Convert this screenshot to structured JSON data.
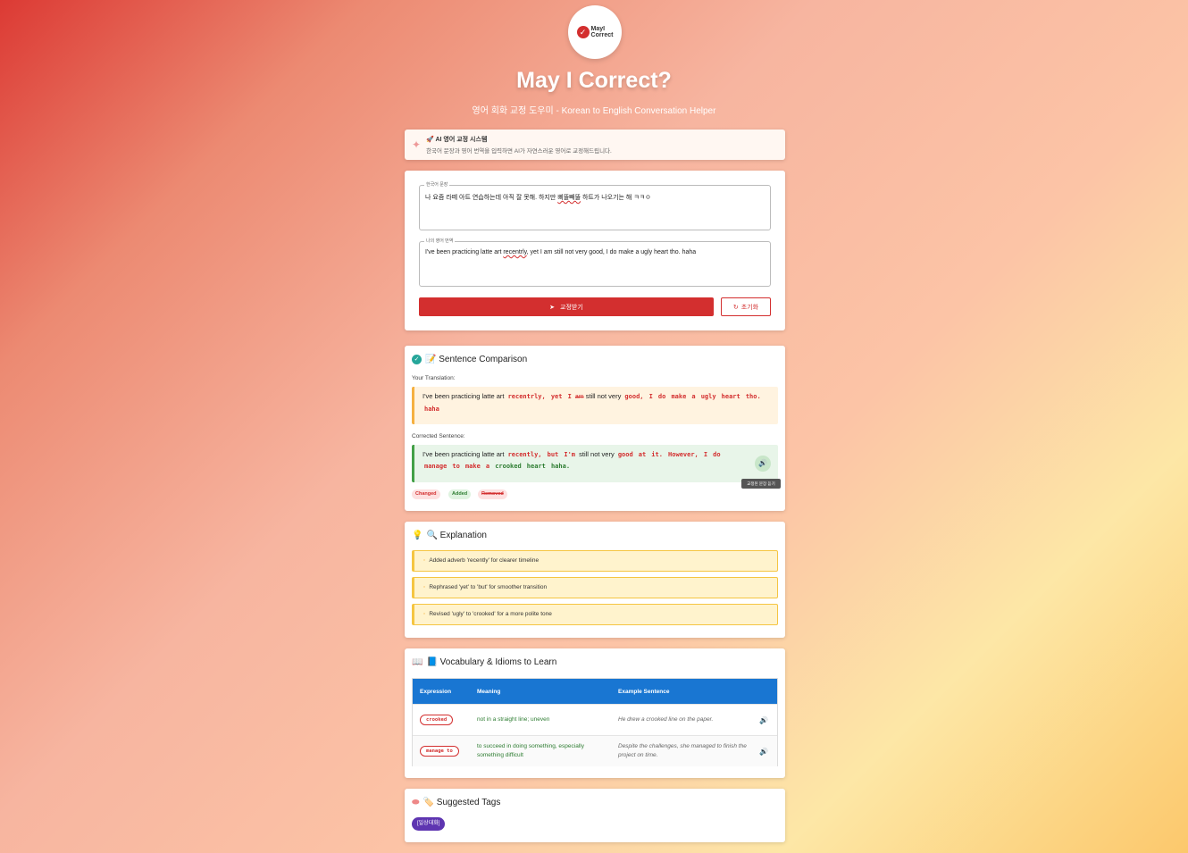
{
  "header": {
    "logo_line1": "MayI",
    "logo_line2": "Correct",
    "title": "May I Correct?",
    "subtitle": "영어 회화 교정 도우미 - Korean to English Conversation Helper"
  },
  "banner": {
    "title": "🚀 AI 영어 교정 시스템",
    "text": "한국어 문장과 영어 번역을 입력하면 AI가 자연스러운 영어로 교정해드립니다."
  },
  "form": {
    "korean_label": "한국어 문장",
    "korean_value_a": "나 요즘 라떼 아트 연습하는데 아직 잘 못해. 하지만 ",
    "korean_value_spell": "삐뚤빼뚤",
    "korean_value_b": " 하트가 나오기는 해 ㅋㅋㅇ",
    "english_label": "나의 영어 번역",
    "english_value_a": "I've been practicing latte art ",
    "english_value_spell": "recentrly",
    "english_value_b": ", yet I am still not very good, I do make a ugly heart tho. haha",
    "submit_label": "교정받기",
    "reset_label": "초기화"
  },
  "comparison": {
    "title": "📝 Sentence Comparison",
    "your_label": "Your Translation:",
    "your": {
      "t1": "I've been practicing latte art",
      "c1": "recentrly,",
      "c2": "yet",
      "c3": "I",
      "r1": "am",
      "t2": "still not very",
      "c4": "good,",
      "c5": "I",
      "c6": "do",
      "c7": "make",
      "c8": "a",
      "c9": "ugly",
      "c10": "heart",
      "c11": "tho.",
      "c12": "haha"
    },
    "corrected_label": "Corrected Sentence:",
    "corrected": {
      "t1": "I've been practicing latte art",
      "c1": "recently,",
      "c2": "but",
      "c3": "I'm",
      "t2": "still not very",
      "c4": "good",
      "c5": "at",
      "c6": "it.",
      "c7": "However,",
      "c8": "I",
      "c9": "do",
      "c10": "manage",
      "c11": "to",
      "c12": "make",
      "c13": "a",
      "a1": "crooked",
      "a2": "heart",
      "a3": "haha."
    },
    "tooltip": "교정된 문장 듣기",
    "legend": {
      "changed": "Changed",
      "added": "Added",
      "removed": "Removed"
    }
  },
  "explanation": {
    "title": "🔍 Explanation",
    "items": [
      "Added adverb 'recently' for clearer timeline",
      "Rephrased 'yet' to 'but' for smoother transition",
      "Revised 'ugly' to 'crooked' for a more polite tone"
    ]
  },
  "vocabulary": {
    "title": "📘 Vocabulary & Idioms to Learn",
    "headers": {
      "expression": "Expression",
      "meaning": "Meaning",
      "example": "Example Sentence"
    },
    "rows": [
      {
        "expression": "crooked",
        "meaning": "not in a straight line; uneven",
        "example": "He drew a crooked line on the paper."
      },
      {
        "expression": "manage to",
        "meaning": "to succeed in doing something, especially something difficult",
        "example": "Despite the challenges, she managed to finish the project on time."
      }
    ]
  },
  "tags": {
    "title": "🏷️ Suggested Tags",
    "items": [
      "[일상대화]"
    ]
  },
  "colors": {
    "primary": "#d32f2f",
    "accent_blue": "#1976d2",
    "added_green": "#2e7d32",
    "tag_purple": "#5e35b1"
  }
}
